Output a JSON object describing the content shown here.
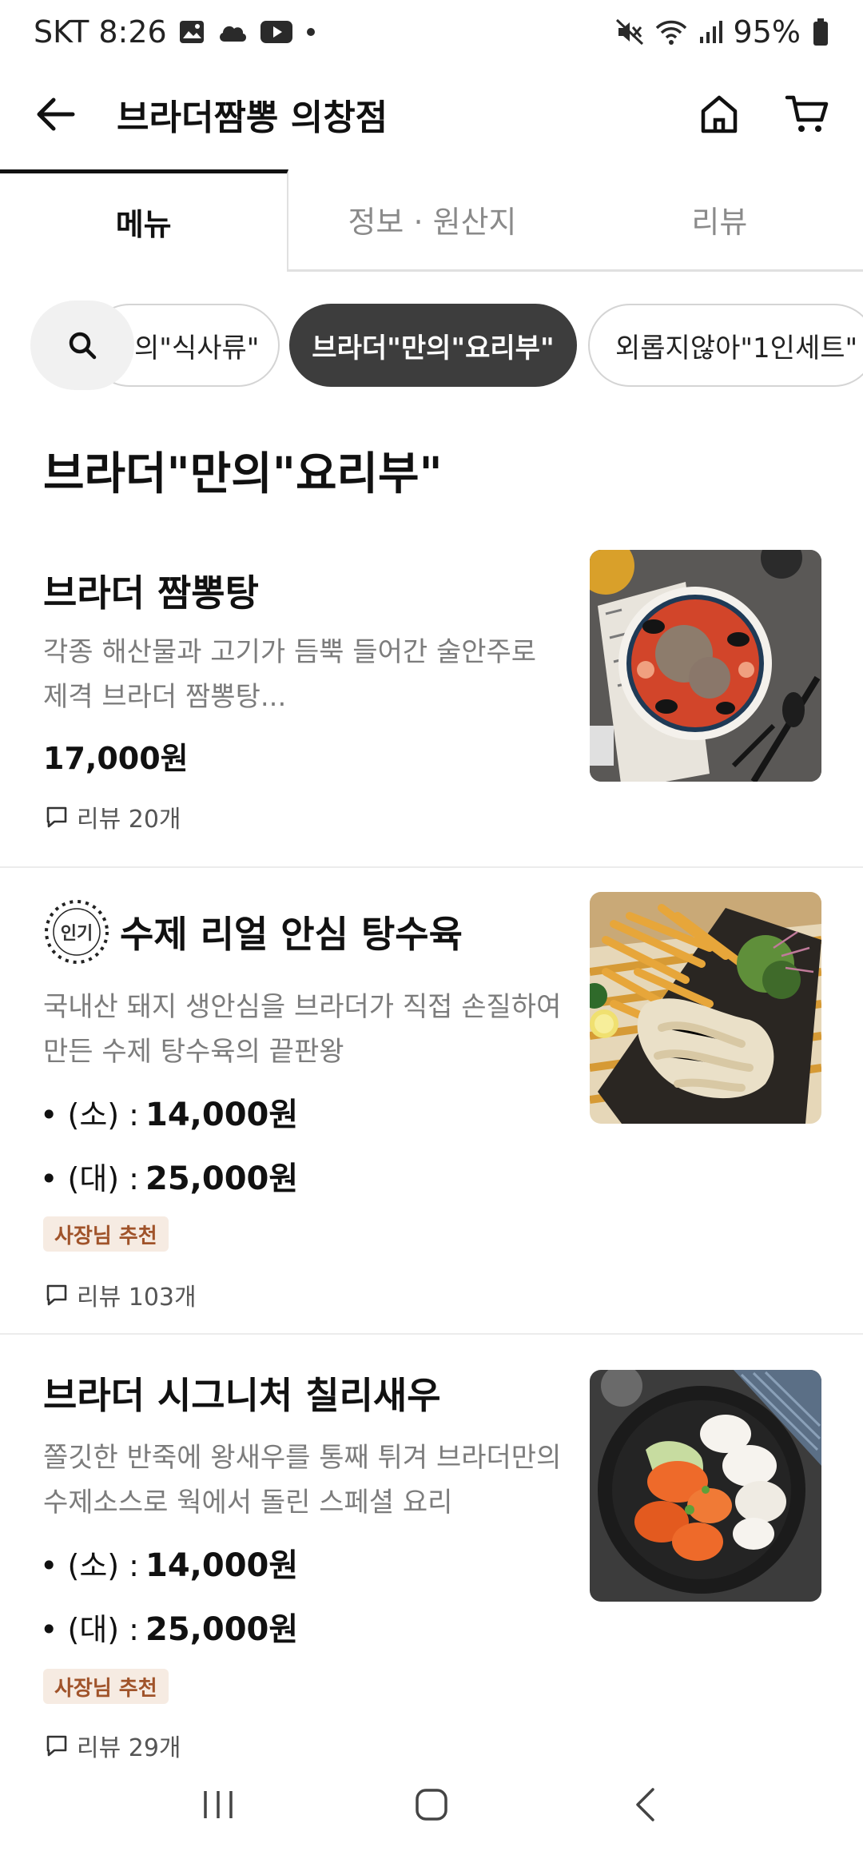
{
  "status_bar": {
    "carrier_time": "SKT 8:26",
    "battery": "95%"
  },
  "header": {
    "title": "브라더짬뽕 의창점"
  },
  "tabs": [
    {
      "label": "메뉴"
    },
    {
      "label": "정보 · 원산지"
    },
    {
      "label": "리뷰"
    }
  ],
  "chips": [
    {
      "label": "의\"식사류\""
    },
    {
      "label": "브라더\"만의\"요리부\""
    },
    {
      "label": "외롭지않아\"1인세트\""
    }
  ],
  "section": {
    "title": "브라더\"만의\"요리부\""
  },
  "items": [
    {
      "name": "브라더 짬뽕탕",
      "desc_line1": "각종 해산물과 고기가 듬뿍 들어간 술안주로",
      "desc_line2": "제격 브라더 짬뽕탕...",
      "price": "17,000원",
      "review": "리뷰 20개"
    },
    {
      "popular_badge": "인기",
      "name": "수제 리얼 안심 탕수육",
      "desc_line1": "국내산 돼지 생안심을 브라더가 직접 손질하여",
      "desc_line2": "만든 수제 탕수육의 끝판왕",
      "options": [
        {
          "size": "• (소) :",
          "price": "14,000원"
        },
        {
          "size": "• (대) :",
          "price": "25,000원"
        }
      ],
      "badge": "사장님 추천",
      "review": "리뷰 103개"
    },
    {
      "name": "브라더 시그니처 칠리새우",
      "desc_line1": "쫄깃한 반죽에 왕새우를 통째 튀겨 브라더만의",
      "desc_line2": "수제소스로 웍에서 돌린 스페셜 요리",
      "options": [
        {
          "size": "• (소) :",
          "price": "14,000원"
        },
        {
          "size": "• (대) :",
          "price": "25,000원"
        }
      ],
      "badge": "사장님 추천",
      "review": "리뷰 29개"
    }
  ]
}
